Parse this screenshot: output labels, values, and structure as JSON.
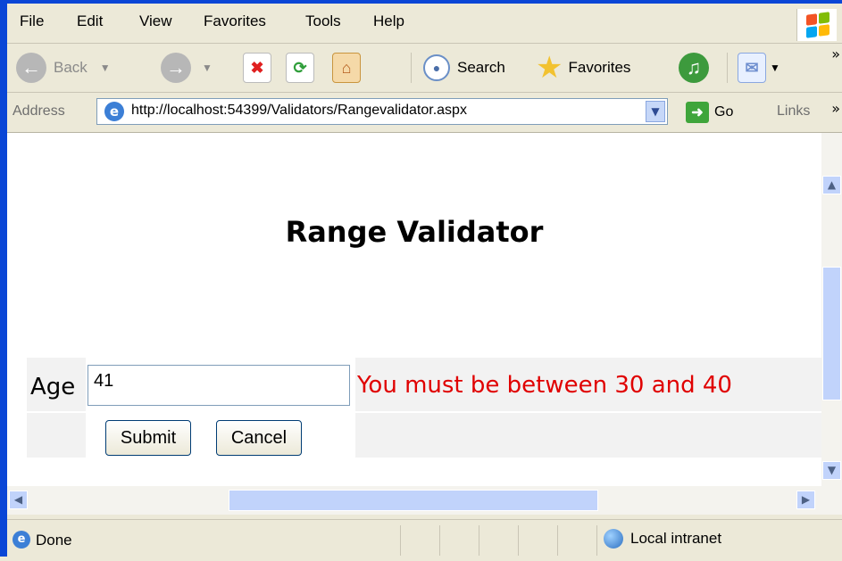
{
  "menubar": {
    "items": [
      "File",
      "Edit",
      "View",
      "Favorites",
      "Tools",
      "Help"
    ]
  },
  "toolbar": {
    "back_label": "Back",
    "search_label": "Search",
    "favorites_label": "Favorites",
    "overflow": "»"
  },
  "address_bar": {
    "label": "Address",
    "url": "http://localhost:54399/Validators/Rangevalidator.aspx",
    "go_label": "Go",
    "links_label": "Links",
    "overflow": "»"
  },
  "page": {
    "title": "Range Validator",
    "age_label": "Age",
    "age_value": "41",
    "error_message": "You must be between 30 and 40",
    "submit_label": "Submit",
    "cancel_label": "Cancel"
  },
  "status_bar": {
    "status": "Done",
    "zone": "Local intranet"
  },
  "colors": {
    "error": "#e00000",
    "title_bar": "#0a46d6"
  }
}
